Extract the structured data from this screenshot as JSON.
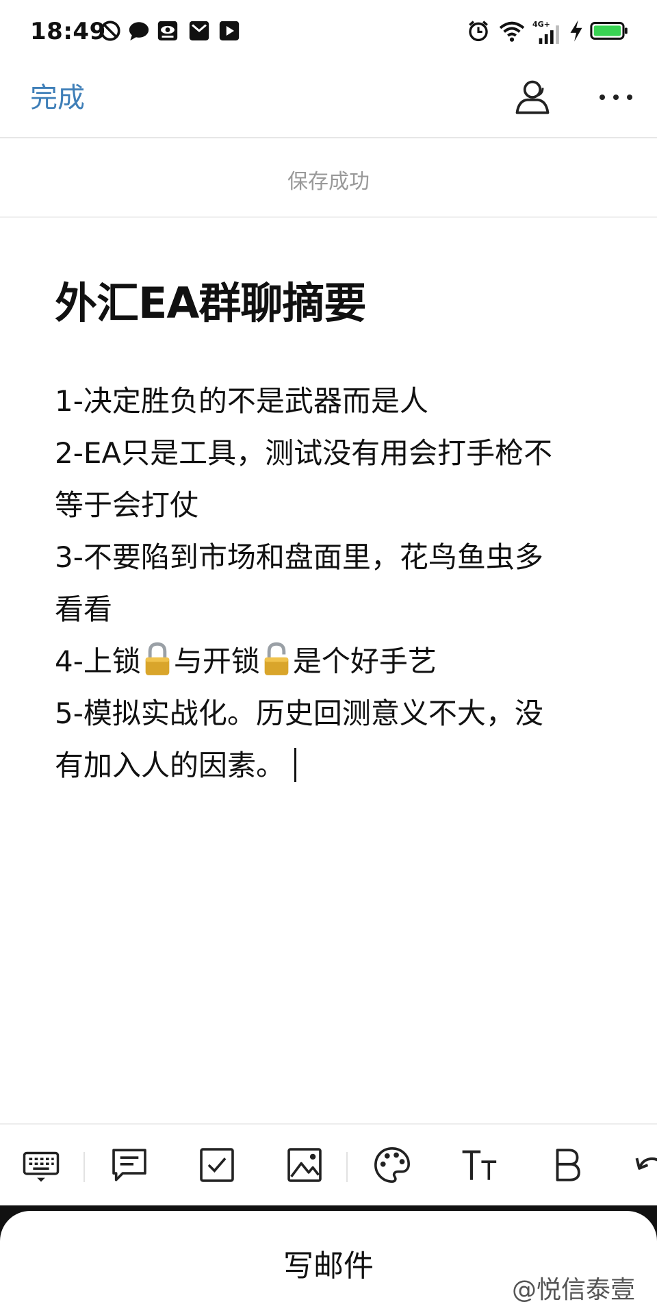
{
  "status_bar": {
    "time": "18:49",
    "network": "4G+",
    "left_icons": [
      "do-not-disturb-icon",
      "chat-bubble-icon",
      "eye-app-icon",
      "mail-icon",
      "video-play-icon"
    ],
    "right_icons": [
      "alarm-icon",
      "wifi-icon",
      "signal-icon",
      "charging-bolt-icon",
      "battery-icon"
    ],
    "battery_color": "#39d353"
  },
  "header": {
    "done_label": "完成",
    "accent_color": "#3f7fb8",
    "icons": [
      "collaborate-icon",
      "more-icon"
    ]
  },
  "save_status": "保存成功",
  "note": {
    "title": "外汇EA群聊摘要",
    "lines": {
      "l1": "1-决定胜负的不是武器而是人",
      "l2a": "2-EA只是工具，测试没有用会打手枪不",
      "l2b": "等于会打仗",
      "l3a": "3-不要陷到市场和盘面里，花鸟鱼虫多",
      "l3b": "看看",
      "l4_part1": "4-上锁",
      "l4_part2": "与开锁",
      "l4_part3": "是个好手艺",
      "l5a": "5-模拟实战化。历史回测意义不大，没",
      "l5b": "有加入人的因素。"
    }
  },
  "toolbar": {
    "icons": [
      "keyboard-icon",
      "comment-icon",
      "checkbox-icon",
      "image-icon",
      "palette-icon",
      "text-size-icon",
      "bold-icon",
      "undo-icon"
    ]
  },
  "compose": {
    "label": "写邮件"
  },
  "watermark": "@悦信泰壹"
}
